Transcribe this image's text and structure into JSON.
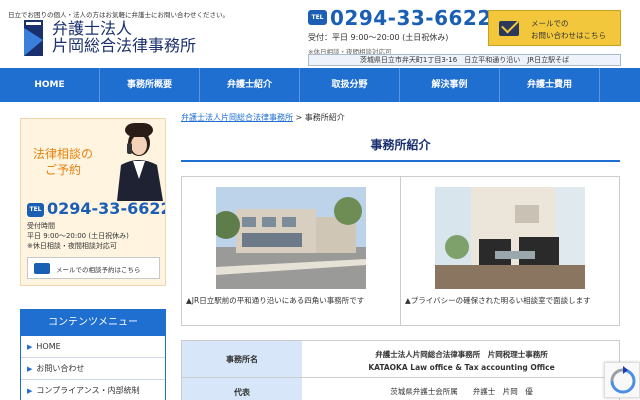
{
  "header": {
    "tagline": "日立でお困りの個人・法人の方はお気軽に弁護士にお問い合わせください。",
    "firm_name_line1": "弁護士法人",
    "firm_name_line2": "片岡総合法律事務所",
    "tel_icon": "TEL",
    "tel_number": "0294-33-6622",
    "hours": "受付：平日 9:00〜20:00 (土日祝休み)",
    "hours_note": "※休日相談・夜間相談対応可",
    "address": "茨城県日立市弁天町1丁目3-16　日立平和通り沿い　JR日立駅そば",
    "mail_line1": "メールでの",
    "mail_line2": "お問い合わせはこちら",
    "colors": {
      "brand_blue": "#1f6fd1",
      "accent_yellow": "#f3c73b",
      "navy": "#1a2f6e"
    }
  },
  "nav": {
    "items": [
      "HOME",
      "事務所概要",
      "弁護士紹介",
      "取扱分野",
      "解決事例",
      "弁護士費用",
      "お問"
    ]
  },
  "sidebar": {
    "promo": {
      "title_line1": "法律相談の",
      "title_line2": "ご予約",
      "tel_icon": "TEL",
      "tel_number": "0294-33-6622",
      "hours_line1": "受付時間",
      "hours_line2": "平日 9:00〜20:00 (土日祝休み)",
      "hours_line3": "※休日相談・夜間相談対応可",
      "mail_label": "メールでの相談予約はこちら"
    },
    "menu": {
      "title": "コンテンツメニュー",
      "items": [
        "HOME",
        "お問い合わせ",
        "コンプライアンス・内部統制"
      ]
    }
  },
  "main": {
    "breadcrumb_link": "弁護士法人片岡総合法律事務所",
    "breadcrumb_sep": " > ",
    "breadcrumb_current": "事務所紹介",
    "title": "事務所紹介",
    "photos": [
      {
        "caption": "▲JR日立駅前の平和通り沿いにある四角い事務所です"
      },
      {
        "caption": "▲プライバシーの確保された明るい相談室で面談します"
      }
    ],
    "info": [
      {
        "label": "事務所名",
        "value_line1": "弁護士法人片岡総合法律事務所　片岡税理士事務所",
        "value_line2": "KATAOKA Law office & Tax accounting Office"
      },
      {
        "label": "代表",
        "value_line1": "茨城県弁護士会所属　　弁護士　片岡　優",
        "value_line2": ""
      }
    ]
  }
}
